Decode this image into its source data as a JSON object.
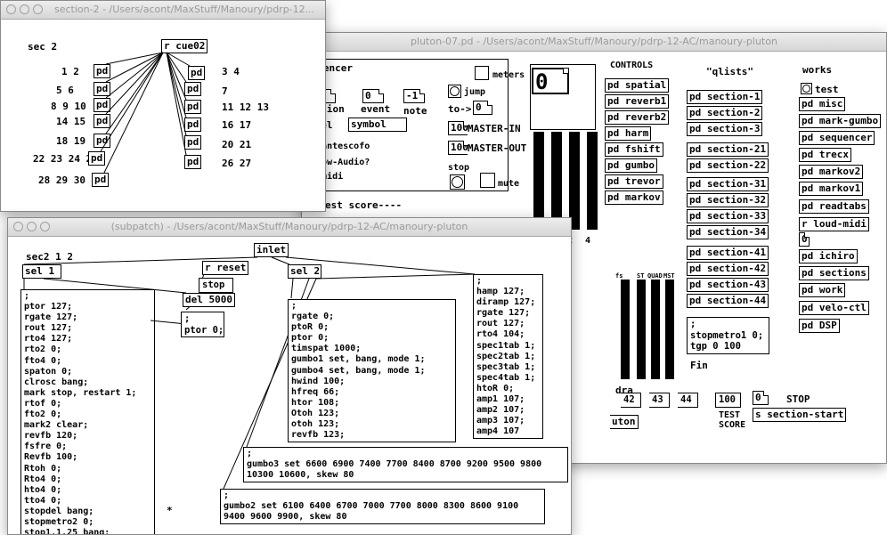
{
  "windows": {
    "pluton": {
      "title": "pluton-07.pd  -  /Users/acont/MaxStuff/Manoury/pdrp-12-AC/manoury-pluton",
      "sequencer": {
        "title": "equencer",
        "meters_label": "meters",
        "jump_label": "jump",
        "section_label": "ection",
        "event_label": "event",
        "note_label": "note",
        "section_value": "",
        "event_value": "0",
        "note_value": "-1",
        "to_label": "to->",
        "to_value": "0",
        "label_label": "abel",
        "label_value": "symbol",
        "master_in_value": "100",
        "master_in_label": "MASTER-IN",
        "master_out_value": "100",
        "master_out_label": "MASTER-OUT",
        "antescofo_label": "ow-antescofo",
        "follow_audio_label": "ollow-Audio?",
        "midi_label": "ow-midi",
        "stop_label": "stop",
        "mute_label": "mute",
        "test_score_label": "est score----"
      },
      "score_display": "0",
      "meter_labels": {
        "in": "IN",
        "asco": "asco2",
        "four": "4",
        "fs": "fs",
        "st": "ST",
        "quad": "QUAD",
        "mst": "MST"
      },
      "controls": {
        "heading": "CONTROLS",
        "items": [
          "pd spatial",
          "pd reverb1",
          "pd reverb2",
          "pd harm",
          "pd fshift",
          "pd gumbo",
          "pd trevor",
          "pd markov"
        ]
      },
      "qlists": {
        "heading": "\"qlists\"",
        "items": [
          "pd section-1",
          "pd section-2",
          "pd section-3",
          "pd section-21",
          "pd section-22",
          "pd section-31",
          "pd section-32",
          "pd section-33",
          "pd section-34",
          "pd section-41",
          "pd section-42",
          "pd section-43",
          "pd section-44"
        ]
      },
      "works": {
        "heading": "works",
        "test_label": "test",
        "items": [
          "pd misc",
          "pd mark-gumbo",
          "pd sequencer",
          "pd trecx",
          "pd markov2",
          "pd markov1",
          "pd readtabs",
          "r loud-midi"
        ],
        "loud_value": "0",
        "items2": [
          "pd ichiro",
          "pd sections",
          "pd work",
          "pd velo-ctl",
          "pd DSP"
        ]
      },
      "stopmetro_msg": ";\nstopmetro1 0;\ntgp 0 100",
      "fin_label": "Fin",
      "dra_label": "dra",
      "bottom_numbers": [
        "42",
        "43",
        "44"
      ],
      "test_score_value": "100",
      "test_score_label": "TEST\nSCORE",
      "stop_value": "0",
      "stop_label": "STOP",
      "section_start": "s section-start",
      "uton_label": "uton"
    },
    "section2": {
      "title": "section-2  -  /Users/acont/MaxStuff/Manoury/pdrp-12...",
      "sec_label": "sec 2",
      "receive": "r cue02",
      "left_labels": [
        "1 2",
        "5 6",
        "8 9 10",
        "14 15",
        "18 19",
        "22 23 24 25",
        "28 29 30"
      ],
      "left_pd": [
        "pd",
        "pd",
        "pd",
        "pd",
        "pd",
        "pd",
        "pd"
      ],
      "right_labels": [
        "3 4",
        "7",
        "11 12 13",
        "16 17",
        "20 21",
        "26 27"
      ],
      "right_pd": [
        "pd",
        "pd",
        "pd",
        "pd",
        "pd",
        "pd"
      ]
    },
    "subpatch": {
      "title": "(subpatch)  -  /Users/acont/MaxStuff/Manoury/pdrp-12-AC/manoury-pluton",
      "sec_label": "sec2 1 2",
      "inlet": "inlet",
      "sel1": "sel 1",
      "sel2": "sel 2",
      "r_reset": "r reset",
      "stop": "stop",
      "del": "del 5000",
      "ptor_msg": ";\nptor 0;",
      "big_msg": ";\nptor 127;\nrgate 127;\nrout 127;\nrto4 127;\nrto2 0;\nfto4 0;\nspaton 0;\nclrosc bang;\nmark stop, restart 1;\nrtof 0;\nfto2 0;\nmark2 clear;\nrevfb 120;\nfsfre 0;\nRevfb 100;\nRtoh 0;\nRto4 0;\nhto4 0;\ntto4 0;\nstopdel bang;\nstopmetro2 0;\nstop1.1.25 bang;",
      "mid_msg": ";\nrgate 0;\nptoR 0;\nptor 0;\ntimspat 1000;\ngumbo1 set, bang, mode 1;\ngumbo4 set, bang, mode 1;\nhwind 100;\nhfreq 66;\nhtor 108;\nOtoh 123;\notoh 123;\nrevfb 123;",
      "right_msg": ";\nhamp 127;\ndiramp 127;\nrgate 127;\nrout 127;\nrto4 104;\nspec1tab 1;\nspec2tab 1;\nspec3tab 1;\nspec4tab 1;\nhtoR 0;\namp1 107;\namp2 107;\namp3 107;\namp4 107",
      "gumbo3_msg": ";\ngumbo3 set 6600 6900 7400 7700 8400 8700 9200 9500 9800\n10300 10600, skew 80",
      "gumbo2_msg": ";\ngumbo2 set 6100 6400 6700 7000 7700 8000 8300 8600 9100\n9400 9600 9900, skew 80",
      "asterisk": "*"
    }
  }
}
